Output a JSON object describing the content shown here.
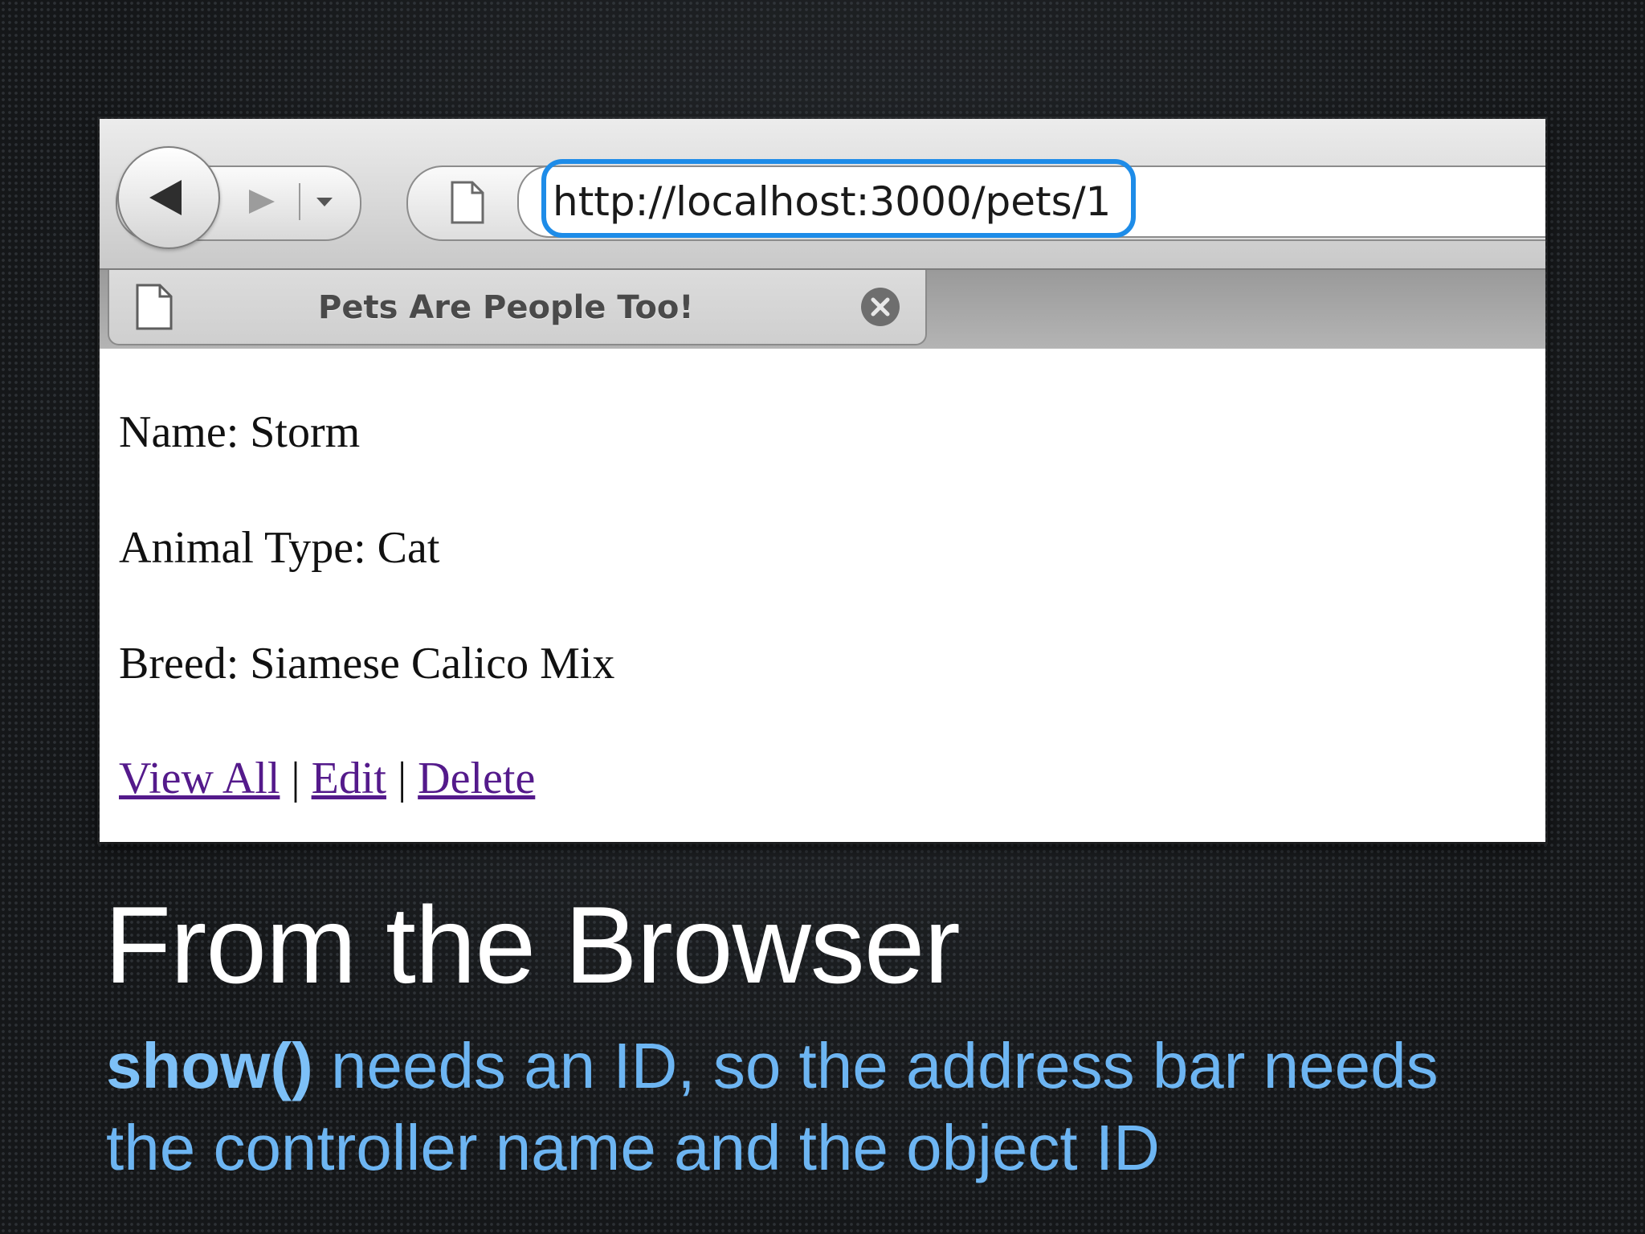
{
  "browser": {
    "address_url": "http://localhost:3000/pets/1",
    "tab_title": "Pets Are People Too!"
  },
  "page": {
    "name_line": "Name: Storm",
    "type_line": "Animal Type: Cat",
    "breed_line": "Breed: Siamese Calico Mix",
    "links": {
      "view_all": "View All",
      "edit": "Edit",
      "delete": "Delete",
      "separator": " | "
    }
  },
  "slide": {
    "title": "From the Browser",
    "subtitle_code": "show()",
    "subtitle_line1": " needs an ID, so the address bar needs",
    "subtitle_line2": "the controller name and the object ID"
  },
  "colors": {
    "highlight": "#1e8ce8",
    "subtitle": "#6db5f2",
    "link_visited": "#541a8b"
  }
}
